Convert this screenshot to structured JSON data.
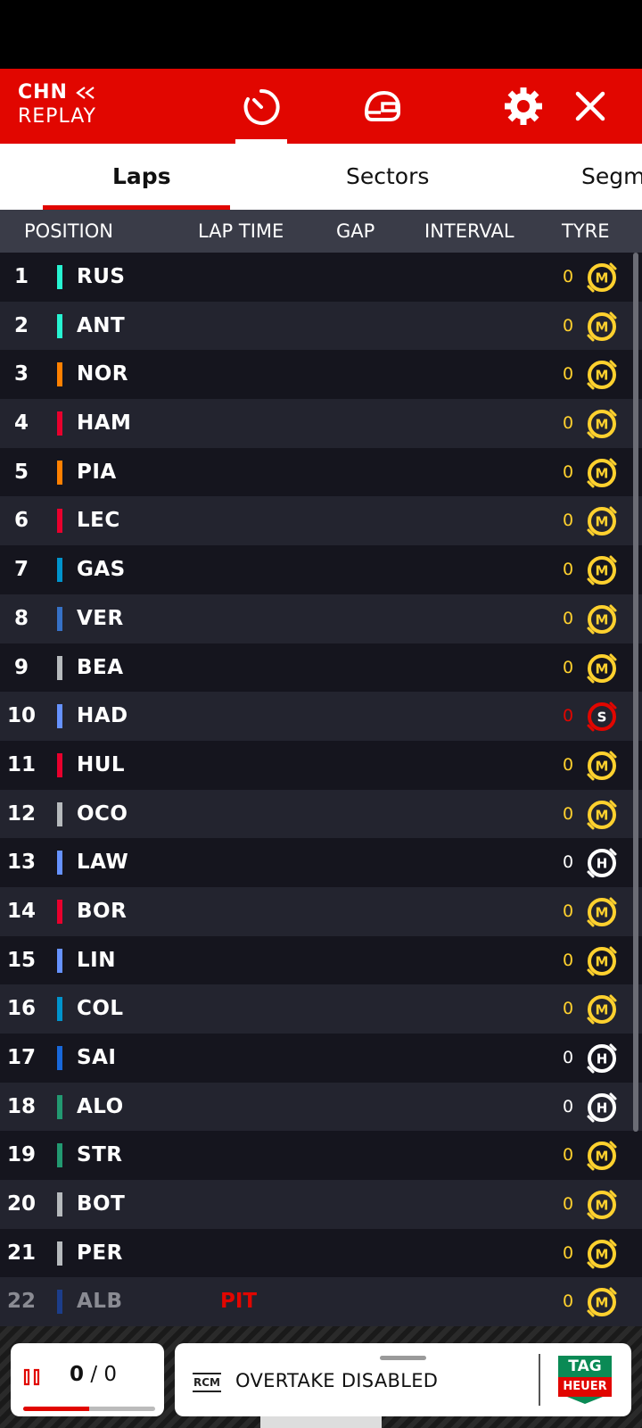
{
  "header": {
    "session_code": "CHN",
    "session_mode": "REPLAY"
  },
  "tabs": [
    {
      "label": "Laps",
      "active": true
    },
    {
      "label": "Sectors",
      "active": false
    },
    {
      "label": "Segm",
      "active": false
    }
  ],
  "columns": {
    "position": "POSITION",
    "lap_time": "LAP TIME",
    "gap": "GAP",
    "interval": "INTERVAL",
    "tyre": "TYRE"
  },
  "drivers": [
    {
      "pos": "1",
      "code": "RUS",
      "team_color": "#27f4d2",
      "laps": "0",
      "tyre": "M",
      "tyre_color": "#ffd12e"
    },
    {
      "pos": "2",
      "code": "ANT",
      "team_color": "#27f4d2",
      "laps": "0",
      "tyre": "M",
      "tyre_color": "#ffd12e"
    },
    {
      "pos": "3",
      "code": "NOR",
      "team_color": "#ff8000",
      "laps": "0",
      "tyre": "M",
      "tyre_color": "#ffd12e"
    },
    {
      "pos": "4",
      "code": "HAM",
      "team_color": "#e8002d",
      "laps": "0",
      "tyre": "M",
      "tyre_color": "#ffd12e"
    },
    {
      "pos": "5",
      "code": "PIA",
      "team_color": "#ff8000",
      "laps": "0",
      "tyre": "M",
      "tyre_color": "#ffd12e"
    },
    {
      "pos": "6",
      "code": "LEC",
      "team_color": "#e8002d",
      "laps": "0",
      "tyre": "M",
      "tyre_color": "#ffd12e"
    },
    {
      "pos": "7",
      "code": "GAS",
      "team_color": "#0093cc",
      "laps": "0",
      "tyre": "M",
      "tyre_color": "#ffd12e"
    },
    {
      "pos": "8",
      "code": "VER",
      "team_color": "#3671c6",
      "laps": "0",
      "tyre": "M",
      "tyre_color": "#ffd12e"
    },
    {
      "pos": "9",
      "code": "BEA",
      "team_color": "#b6babd",
      "laps": "0",
      "tyre": "M",
      "tyre_color": "#ffd12e"
    },
    {
      "pos": "10",
      "code": "HAD",
      "team_color": "#6692ff",
      "laps": "0",
      "tyre": "S",
      "tyre_color": "#e10600"
    },
    {
      "pos": "11",
      "code": "HUL",
      "team_color": "#e8002d",
      "laps": "0",
      "tyre": "M",
      "tyre_color": "#ffd12e"
    },
    {
      "pos": "12",
      "code": "OCO",
      "team_color": "#b6babd",
      "laps": "0",
      "tyre": "M",
      "tyre_color": "#ffd12e"
    },
    {
      "pos": "13",
      "code": "LAW",
      "team_color": "#6692ff",
      "laps": "0",
      "tyre": "H",
      "tyre_color": "#ffffff"
    },
    {
      "pos": "14",
      "code": "BOR",
      "team_color": "#e8002d",
      "laps": "0",
      "tyre": "M",
      "tyre_color": "#ffd12e"
    },
    {
      "pos": "15",
      "code": "LIN",
      "team_color": "#6692ff",
      "laps": "0",
      "tyre": "M",
      "tyre_color": "#ffd12e"
    },
    {
      "pos": "16",
      "code": "COL",
      "team_color": "#0093cc",
      "laps": "0",
      "tyre": "M",
      "tyre_color": "#ffd12e"
    },
    {
      "pos": "17",
      "code": "SAI",
      "team_color": "#1868db",
      "laps": "0",
      "tyre": "H",
      "tyre_color": "#ffffff"
    },
    {
      "pos": "18",
      "code": "ALO",
      "team_color": "#229971",
      "laps": "0",
      "tyre": "H",
      "tyre_color": "#ffffff"
    },
    {
      "pos": "19",
      "code": "STR",
      "team_color": "#229971",
      "laps": "0",
      "tyre": "M",
      "tyre_color": "#ffd12e"
    },
    {
      "pos": "20",
      "code": "BOT",
      "team_color": "#b6babd",
      "laps": "0",
      "tyre": "M",
      "tyre_color": "#ffd12e"
    },
    {
      "pos": "21",
      "code": "PER",
      "team_color": "#b6babd",
      "laps": "0",
      "tyre": "M",
      "tyre_color": "#ffd12e"
    },
    {
      "pos": "22",
      "code": "ALB",
      "team_color": "#1c3d8a",
      "laps": "0",
      "tyre": "M",
      "tyre_color": "#ffd12e",
      "status": "PIT"
    }
  ],
  "footer": {
    "lap_current": "0",
    "lap_separator": "/",
    "lap_total": "0",
    "replay_progress": 0.5,
    "rcm_label": "RCM",
    "rcm_message": "OVERTAKE DISABLED",
    "sponsor_top": "TAG",
    "sponsor_bottom": "HEUER"
  },
  "icons": [
    "rewind-icon",
    "timer-icon",
    "helmet-icon",
    "gear-icon",
    "close-icon",
    "pause-icon",
    "tyre-icon"
  ]
}
